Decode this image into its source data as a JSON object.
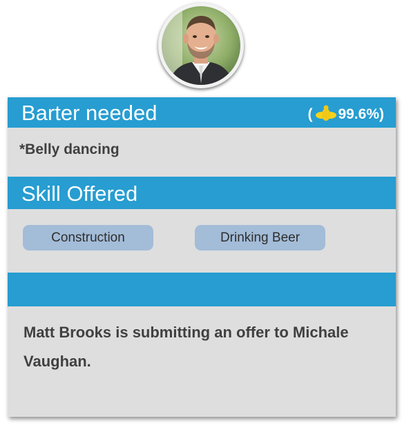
{
  "profile": {
    "avatar_icon": "user-photo"
  },
  "barter": {
    "title": "Barter needed",
    "rating_open": "(",
    "rating_value": "99.6%)",
    "rating_icon": "bee-icon",
    "needed_item": "*Belly dancing"
  },
  "skill": {
    "title": "Skill Offered",
    "tags": [
      "Construction",
      "Drinking Beer"
    ]
  },
  "message": {
    "text": "Matt Brooks is submitting an offer to Michale Vaughan."
  },
  "colors": {
    "band": "#279dd1",
    "card": "#dedede",
    "pill": "#a3bcd8",
    "rating_icon": "#f5d21c"
  }
}
